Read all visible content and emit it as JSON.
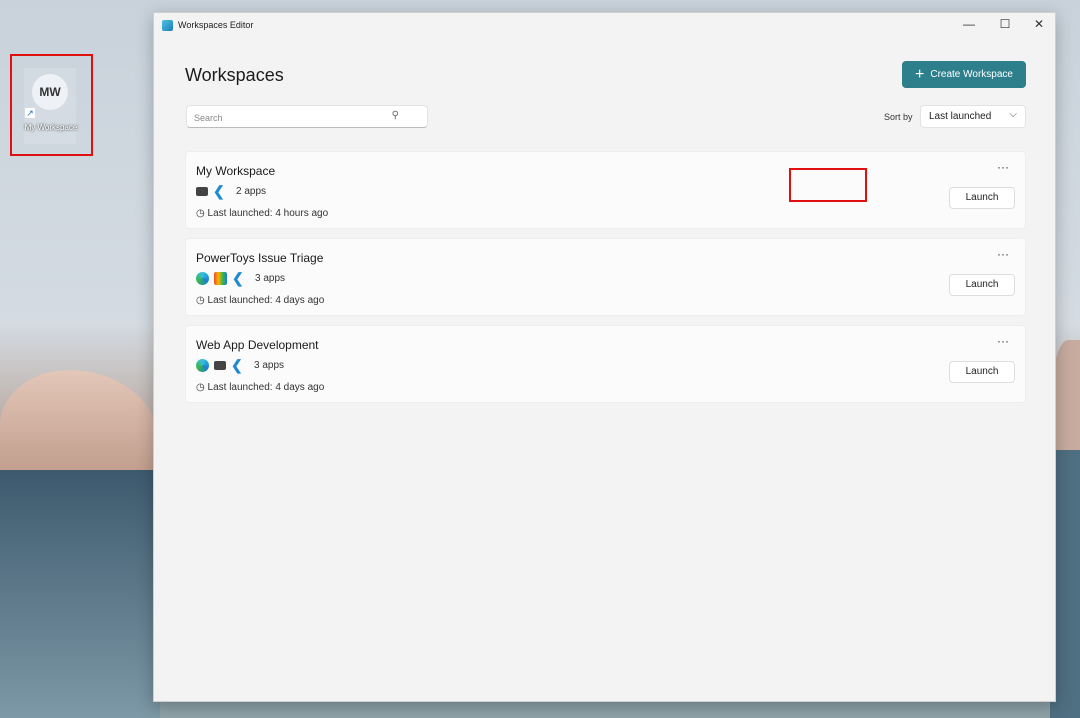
{
  "desktop": {
    "icon_initials": "MW",
    "icon_label": "My Workspace"
  },
  "window": {
    "title": "Workspaces Editor",
    "minimize": "—",
    "maximize": "☐",
    "close": "✕"
  },
  "header": {
    "title": "Workspaces",
    "create_label": "Create Workspace",
    "create_icon": "+"
  },
  "search": {
    "placeholder": "Search",
    "icon": "⚲"
  },
  "sort": {
    "label": "Sort by",
    "value": "Last launched",
    "chevron": "⌵"
  },
  "workspaces": [
    {
      "name": "My Workspace",
      "apps": [
        "terminal",
        "vscode"
      ],
      "app_count": "2 apps",
      "last_launched": "Last launched: 4 hours ago",
      "launch": "Launch",
      "more": "···"
    },
    {
      "name": "PowerToys Issue Triage",
      "apps": [
        "edge",
        "powertoys",
        "vscode"
      ],
      "app_count": "3 apps",
      "last_launched": "Last launched: 4 days ago",
      "launch": "Launch",
      "more": "···"
    },
    {
      "name": "Web App Development",
      "apps": [
        "edge",
        "terminal",
        "vscode"
      ],
      "app_count": "3 apps",
      "last_launched": "Last launched: 4 days ago",
      "launch": "Launch",
      "more": "···"
    }
  ],
  "colors": {
    "accent": "#2e7f8c",
    "highlight": "#e01010"
  }
}
